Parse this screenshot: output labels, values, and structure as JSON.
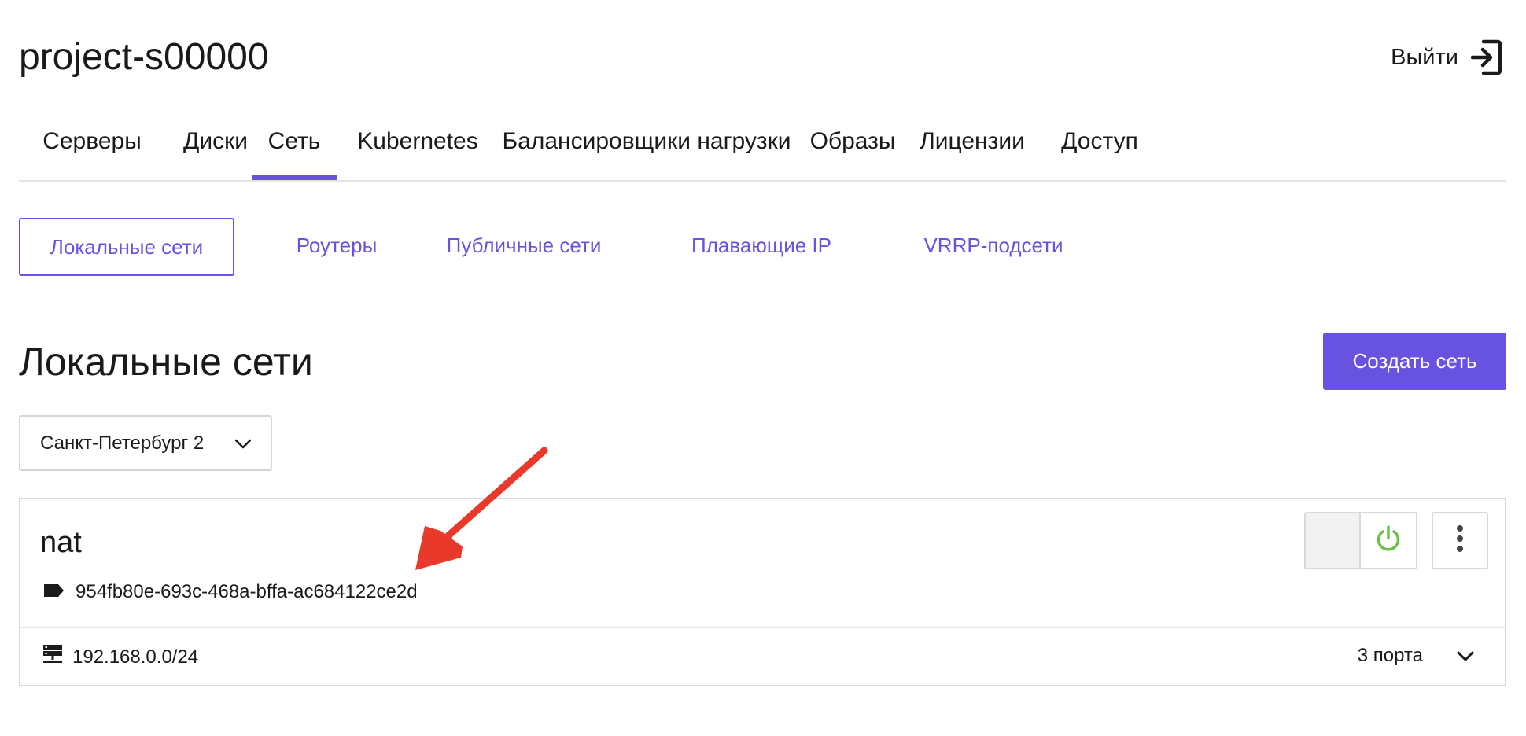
{
  "header": {
    "project_title": "project-s00000",
    "logout_label": "Выйти"
  },
  "tabs": [
    {
      "label": "Серверы"
    },
    {
      "label": "Диски"
    },
    {
      "label": "Сеть",
      "active": true
    },
    {
      "label": "Kubernetes"
    },
    {
      "label": "Балансировщики нагрузки"
    },
    {
      "label": "Образы"
    },
    {
      "label": "Лицензии"
    },
    {
      "label": "Доступ"
    }
  ],
  "subtabs": [
    {
      "label": "Локальные сети",
      "active": true
    },
    {
      "label": "Роутеры"
    },
    {
      "label": "Публичные сети"
    },
    {
      "label": "Плавающие IP"
    },
    {
      "label": "VRRP-подсети"
    }
  ],
  "section": {
    "title": "Локальные сети",
    "create_button": "Создать сеть"
  },
  "region_select": {
    "value": "Санкт-Петербург 2"
  },
  "network": {
    "name": "nat",
    "id": "954fb80e-693c-468a-bffa-ac684122ce2d",
    "subnet": "192.168.0.0/24",
    "ports": "3 порта",
    "power_state": "on"
  },
  "icons": {
    "logout": "logout-icon",
    "dropdown": "chevron-down-icon",
    "id_tag": "tag-icon",
    "subnet": "server-rack-icon",
    "power": "power-icon",
    "more": "more-vertical-icon",
    "expand": "chevron-down-icon"
  },
  "colors": {
    "accent": "#6753e0",
    "power_on": "#6cc04a",
    "annotation": "#e8392a"
  }
}
